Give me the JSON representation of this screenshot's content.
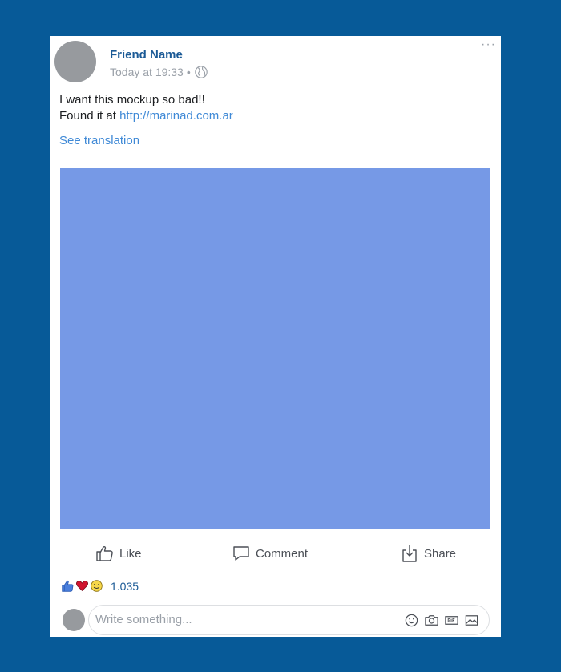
{
  "post": {
    "author": "Friend Name",
    "timestamp": "Today at 19:33",
    "separator": "•",
    "audience_icon": "globe-icon",
    "more_icon": "more-options-icon",
    "more_glyph": "···",
    "text_line1": "I want this mockup so bad!!",
    "text_line2_prefix": "Found it at",
    "link": "http://marinad.com.ar",
    "translation": "See translation",
    "image_color": "#7699e6"
  },
  "actions": {
    "like_label": "Like",
    "comment_label": "Comment",
    "share_label": "Share"
  },
  "reactions": {
    "icons": [
      "like-reaction-icon",
      "love-reaction-icon",
      "haha-reaction-icon"
    ],
    "count": "1.035"
  },
  "comment_box": {
    "placeholder": "Write something...",
    "icons": [
      "emoji-icon",
      "camera-icon",
      "gif-icon",
      "sticker-icon"
    ]
  },
  "colors": {
    "page_background": "#075a98",
    "author": "#1b5a96",
    "link": "#3f89d6"
  }
}
